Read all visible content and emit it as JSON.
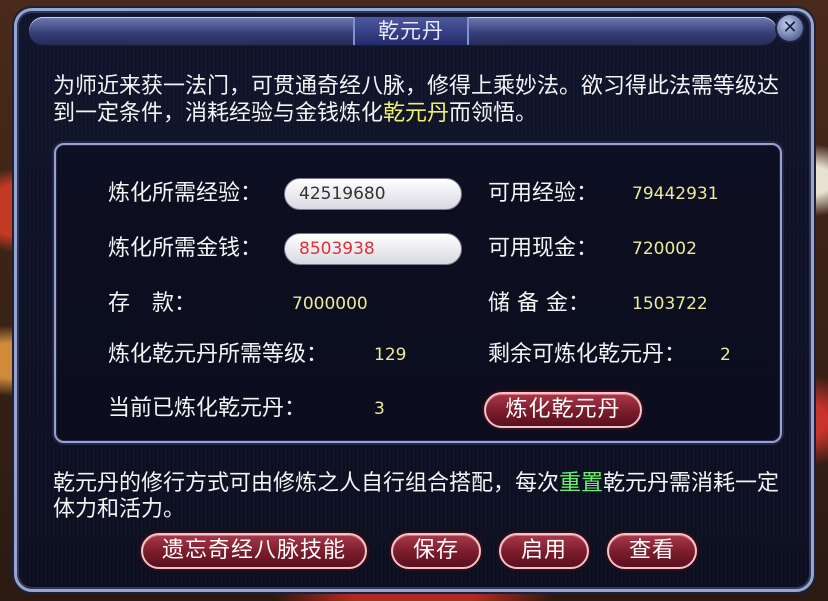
{
  "window": {
    "title": "乾元丹",
    "close_glyph": "✕"
  },
  "intro": {
    "text_before": "为师近来获一法门，可贯通奇经八脉，修得上乘妙法。欲习得此法需等级达到一定条件，消耗经验与金钱炼化",
    "highlight": "乾元丹",
    "text_after": "而领悟。"
  },
  "stats": {
    "required_exp_label": "炼化所需经验：",
    "required_exp_value": "42519680",
    "available_exp_label": "可用经验：",
    "available_exp_value": "79442931",
    "required_money_label": "炼化所需金钱：",
    "required_money_value": "8503938",
    "available_cash_label": "可用现金：",
    "available_cash_value": "720002",
    "deposit_label": "存　款：",
    "deposit_value": "7000000",
    "reserve_label": "储 备 金：",
    "reserve_value": "1503722",
    "required_level_label": "炼化乾元丹所需等级：",
    "required_level_value": "129",
    "remaining_label": "剩余可炼化乾元丹：",
    "remaining_value": "2",
    "current_label": "当前已炼化乾元丹：",
    "current_value": "3"
  },
  "buttons": {
    "refine": "炼化乾元丹",
    "forget": "遗忘奇经八脉技能",
    "save": "保存",
    "enable": "启用",
    "view": "查看"
  },
  "note": {
    "text_before": "乾元丹的修行方式可由修炼之人自行组合搭配，每次",
    "highlight": "重置",
    "text_after": "乾元丹需消耗一定体力和活力。"
  },
  "colors": {
    "label_text": "#f4f4f4",
    "value_text": "#eaea9a",
    "highlight_yellow": "#f0f06a",
    "highlight_green": "#6cf06a",
    "money_red": "#e0303a",
    "button_red": "#7a1c2c",
    "window_bg": "#0c0f20"
  }
}
